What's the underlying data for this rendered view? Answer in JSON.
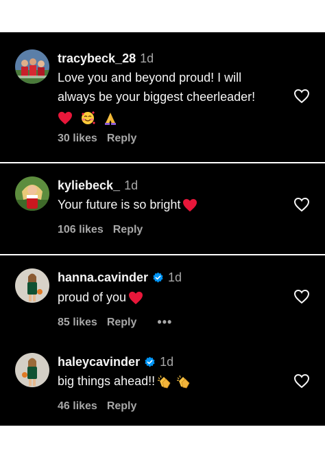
{
  "comments": [
    {
      "username": "tracybeck_28",
      "time": "1d",
      "verified": false,
      "text_lines": [
        "Love you and beyond proud! I will",
        "always be your biggest cheerleader!"
      ],
      "emojis": [
        "red-heart",
        "smiling-face-with-hearts",
        "folded-hands"
      ],
      "likes": "30 likes",
      "reply": "Reply"
    },
    {
      "username": "kyliebeck_",
      "time": "1d",
      "verified": false,
      "text": "Your future is so bright",
      "emojis": [
        "red-heart"
      ],
      "likes": "106 likes",
      "reply": "Reply"
    },
    {
      "username": "hanna.cavinder",
      "time": "1d",
      "verified": true,
      "text": "proud of you",
      "emojis": [
        "red-heart"
      ],
      "likes": "85 likes",
      "reply": "Reply",
      "more": "•••"
    },
    {
      "username": "haleycavinder",
      "time": "1d",
      "verified": true,
      "text": "big things ahead!!",
      "emojis": [
        "clapping-hands",
        "clapping-hands"
      ],
      "likes": "46 likes",
      "reply": "Reply"
    }
  ],
  "colors": {
    "background": "#000000",
    "text": "#f5f5f5",
    "secondary_text": "#a8a8a8",
    "verified_blue": "#0095f6",
    "heart_red": "#ff3040"
  }
}
